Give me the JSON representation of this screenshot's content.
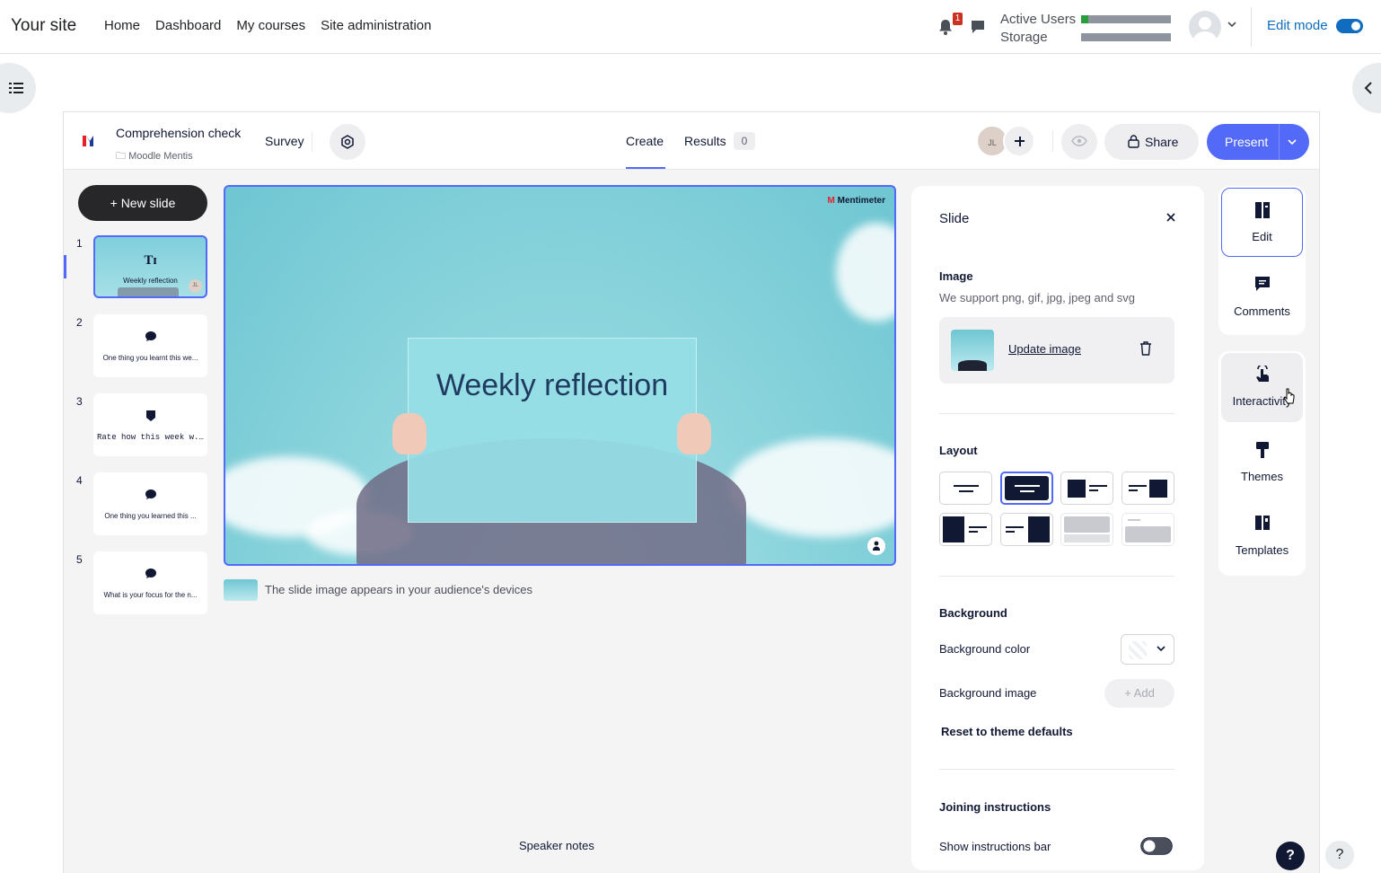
{
  "moodle": {
    "site_name": "Your site",
    "nav": [
      "Home",
      "Dashboard",
      "My courses",
      "Site administration"
    ],
    "notification_count": "1",
    "usage_labels": [
      "Active Users",
      "Storage"
    ],
    "usage_fill": [
      0.08,
      0.0
    ],
    "edit_mode_label": "Edit mode",
    "edit_mode_on": true
  },
  "menti": {
    "presentation_title": "Comprehension check",
    "folder": "Moodle Mentis",
    "type_label": "Survey",
    "tabs": {
      "create": "Create",
      "results": "Results",
      "results_count": "0"
    },
    "collaborator_initials": "JL",
    "share_label": "Share",
    "present_label": "Present",
    "new_slide_label": "New slide",
    "slides": [
      {
        "num": "1",
        "text": "Weekly reflection",
        "icon": "text-icon",
        "active": true
      },
      {
        "num": "2",
        "text": "One thing you learnt this we...",
        "icon": "speech-bubble-icon"
      },
      {
        "num": "3",
        "text": "Rate how this week w...",
        "icon": "shield-icon"
      },
      {
        "num": "4",
        "text": "One thing you learned this ...",
        "icon": "speech-bubble-icon"
      },
      {
        "num": "5",
        "text": "What is your focus for the n...",
        "icon": "speech-bubble-icon"
      }
    ],
    "canvas": {
      "heading": "Weekly reflection",
      "watermark": "Mentimeter"
    },
    "image_note": "The slide image appears in your audience's devices",
    "speaker_notes": "Speaker notes"
  },
  "panel": {
    "title": "Slide",
    "image_heading": "Image",
    "image_sub": "We support png, gif, jpg, jpeg and svg",
    "update_image": "Update image",
    "layout_heading": "Layout",
    "background_heading": "Background",
    "background_color_label": "Background color",
    "background_image_label": "Background image",
    "add_label": "+ Add",
    "reset_label": "Reset to theme defaults",
    "joining_heading": "Joining instructions",
    "show_bar_label": "Show instructions bar"
  },
  "rail": {
    "edit": "Edit",
    "comments": "Comments",
    "interactivity": "Interactivity",
    "themes": "Themes",
    "templates": "Templates"
  },
  "colors": {
    "accent": "#5369f8",
    "moodle_blue": "#0f6cbf",
    "dark": "#101834"
  }
}
